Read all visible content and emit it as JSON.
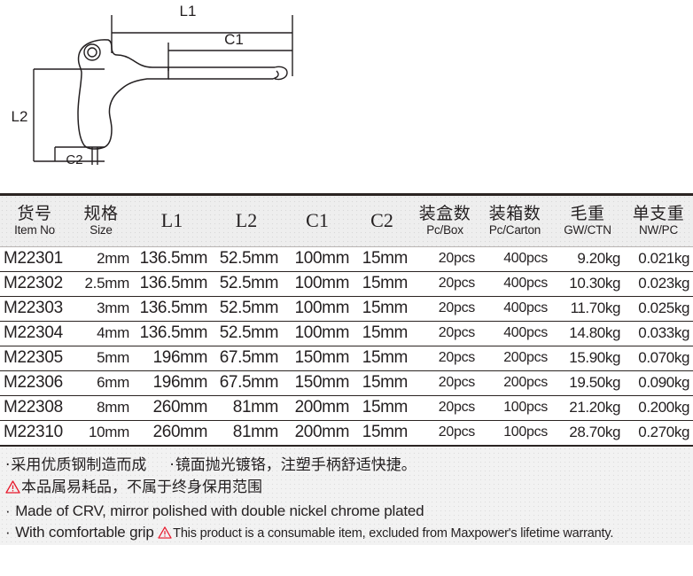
{
  "diagram": {
    "title": "t-handle-hex-key-dimension-drawing",
    "labels": {
      "l1": "L1",
      "l2": "L2",
      "c1": "C1",
      "c2": "C2"
    }
  },
  "table": {
    "headers": [
      {
        "cn": "货号",
        "en": "Item No",
        "key": "item_no"
      },
      {
        "cn": "规格",
        "en": "Size",
        "key": "size"
      },
      {
        "dim": "L1",
        "key": "l1"
      },
      {
        "dim": "L2",
        "key": "l2"
      },
      {
        "dim": "C1",
        "key": "c1"
      },
      {
        "dim": "C2",
        "key": "c2"
      },
      {
        "cn": "装盒数",
        "en": "Pc/Box",
        "key": "pc_box"
      },
      {
        "cn": "装箱数",
        "en": "Pc/Carton",
        "key": "pc_carton"
      },
      {
        "cn": "毛重",
        "en": "GW/CTN",
        "key": "gw_ctn"
      },
      {
        "cn": "单支重",
        "en": "NW/PC",
        "key": "nw_pc"
      }
    ],
    "rows": [
      {
        "item_no": "M22301",
        "size": "2mm",
        "l1": "136.5mm",
        "l2": "52.5mm",
        "c1": "100mm",
        "c2": "15mm",
        "pc_box": "20pcs",
        "pc_carton": "400pcs",
        "gw_ctn": "9.20kg",
        "nw_pc": "0.021kg"
      },
      {
        "item_no": "M22302",
        "size": "2.5mm",
        "l1": "136.5mm",
        "l2": "52.5mm",
        "c1": "100mm",
        "c2": "15mm",
        "pc_box": "20pcs",
        "pc_carton": "400pcs",
        "gw_ctn": "10.30kg",
        "nw_pc": "0.023kg"
      },
      {
        "item_no": "M22303",
        "size": "3mm",
        "l1": "136.5mm",
        "l2": "52.5mm",
        "c1": "100mm",
        "c2": "15mm",
        "pc_box": "20pcs",
        "pc_carton": "400pcs",
        "gw_ctn": "11.70kg",
        "nw_pc": "0.025kg"
      },
      {
        "item_no": "M22304",
        "size": "4mm",
        "l1": "136.5mm",
        "l2": "52.5mm",
        "c1": "100mm",
        "c2": "15mm",
        "pc_box": "20pcs",
        "pc_carton": "400pcs",
        "gw_ctn": "14.80kg",
        "nw_pc": "0.033kg"
      },
      {
        "item_no": "M22305",
        "size": "5mm",
        "l1": "196mm",
        "l2": "67.5mm",
        "c1": "150mm",
        "c2": "15mm",
        "pc_box": "20pcs",
        "pc_carton": "200pcs",
        "gw_ctn": "15.90kg",
        "nw_pc": "0.070kg"
      },
      {
        "item_no": "M22306",
        "size": "6mm",
        "l1": "196mm",
        "l2": "67.5mm",
        "c1": "150mm",
        "c2": "15mm",
        "pc_box": "20pcs",
        "pc_carton": "200pcs",
        "gw_ctn": "19.50kg",
        "nw_pc": "0.090kg"
      },
      {
        "item_no": "M22308",
        "size": "8mm",
        "l1": "260mm",
        "l2": "81mm",
        "c1": "200mm",
        "c2": "15mm",
        "pc_box": "20pcs",
        "pc_carton": "100pcs",
        "gw_ctn": "21.20kg",
        "nw_pc": "0.200kg"
      },
      {
        "item_no": "M22310",
        "size": "10mm",
        "l1": "260mm",
        "l2": "81mm",
        "c1": "200mm",
        "c2": "15mm",
        "pc_box": "20pcs",
        "pc_carton": "100pcs",
        "gw_ctn": "28.70kg",
        "nw_pc": "0.270kg"
      }
    ]
  },
  "notes": {
    "bullet": "·",
    "cn_line1_a": "采用优质钢制造而成",
    "cn_line1_b": "镜面抛光镀铬，注塑手柄舒适快捷。",
    "cn_line2": "本品属易耗品，不属于终身保用范围",
    "en_line1": "Made of CRV, mirror polished with double nickel chrome plated",
    "en_line2_a": "With comfortable grip",
    "en_line2_b": "This product is a consumable item, excluded from Maxpower's lifetime warranty."
  },
  "colors": {
    "ink": "#231f20",
    "warning_red": "#e8192c",
    "header_bg": "#eeeeee",
    "notes_bg": "#f2f2f2"
  }
}
